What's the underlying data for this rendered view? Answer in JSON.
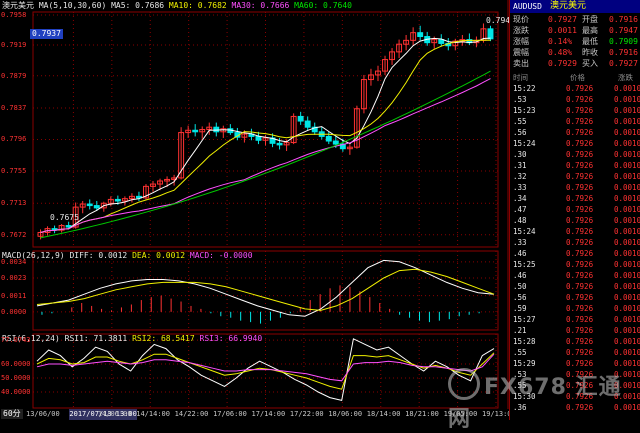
{
  "main_chart": {
    "symbol_label": "澳元美元",
    "ma_title": "MA(5,10,30,60)",
    "ma5": "MA5: 0.7686",
    "ma10": "MA10: 0.7682",
    "ma30": "MA30: 0.7666",
    "ma60": "MA60: 0.7640",
    "current_price_tag": "0.7937",
    "high_label": "0.7947",
    "low_label": "0.7675",
    "y_ticks": [
      "0.7958",
      "0.7919",
      "0.7879",
      "0.7837",
      "0.7796",
      "0.7755",
      "0.7713",
      "0.7672"
    ]
  },
  "macd": {
    "title": "MACD(26,12,9)",
    "diff": "DIFF: 0.0012",
    "dea": "DEA: 0.0012",
    "macd": "MACD: -0.0000",
    "y_ticks": [
      "0.0034",
      "0.0023",
      "0.0011",
      "0.0000"
    ]
  },
  "rsi": {
    "title": "RSI(6,12,24)",
    "rsi1": "RSI1: 71.3811",
    "rsi2": "RSI2: 68.5417",
    "rsi3": "RSI3: 66.9940",
    "y_ticks": [
      "77.0743",
      "60.0000",
      "50.0000",
      "40.0000"
    ]
  },
  "x_axis": {
    "period": "60分",
    "labels": [
      "13/06/00",
      "2017/07/13 13:00",
      "14/06:00",
      "14/14:00",
      "14/22:00",
      "17/06:00",
      "17/14:00",
      "17/22:00",
      "18/06:00",
      "18/14:00",
      "18/21:00",
      "19/05:00",
      "19/13:00"
    ]
  },
  "quote_panel": {
    "code": "AUDUSD",
    "name": "澳元美元",
    "rows": [
      {
        "l1": "现价",
        "v1": "0.7927",
        "l2": "开盘",
        "v2": "0.7916"
      },
      {
        "l1": "涨跌",
        "v1": "0.0011",
        "l2": "最高",
        "v2": "0.7947"
      },
      {
        "l1": "涨幅",
        "v1": "0.14%",
        "l2": "最低",
        "v2": "0.7909"
      },
      {
        "l1": "震幅",
        "v1": "0.48%",
        "l2": "昨收",
        "v2": "0.7916"
      },
      {
        "l1": "卖出",
        "v1": "0.7929",
        "l2": "买入",
        "v2": "0.7927"
      }
    ],
    "header": {
      "time": "时间",
      "price": "价格",
      "change": "涨跌"
    },
    "ticks": [
      {
        "time": "15:22",
        "price": "0.7926",
        "change": "0.0010"
      },
      {
        "time": ".53",
        "price": "0.7926",
        "change": "0.0010"
      },
      {
        "time": "15:23",
        "price": "0.7926",
        "change": "0.0010"
      },
      {
        "time": ".55",
        "price": "0.7926",
        "change": "0.0010"
      },
      {
        "time": ".56",
        "price": "0.7926",
        "change": "0.0010"
      },
      {
        "time": "15:24",
        "price": "0.7926",
        "change": "0.0010"
      },
      {
        "time": ".30",
        "price": "0.7926",
        "change": "0.0010"
      },
      {
        "time": ".31",
        "price": "0.7926",
        "change": "0.0010"
      },
      {
        "time": ".32",
        "price": "0.7926",
        "change": "0.0010"
      },
      {
        "time": ".33",
        "price": "0.7926",
        "change": "0.0010"
      },
      {
        "time": ".34",
        "price": "0.7926",
        "change": "0.0010"
      },
      {
        "time": ".47",
        "price": "0.7926",
        "change": "0.0010"
      },
      {
        "time": ".48",
        "price": "0.7926",
        "change": "0.0010"
      },
      {
        "time": "15:24",
        "price": "0.7926",
        "change": "0.0010"
      },
      {
        "time": ".33",
        "price": "0.7926",
        "change": "0.0010"
      },
      {
        "time": ".46",
        "price": "0.7926",
        "change": "0.0010"
      },
      {
        "time": "15:25",
        "price": "0.7926",
        "change": "0.0010"
      },
      {
        "time": ".46",
        "price": "0.7926",
        "change": "0.0010"
      },
      {
        "time": ".50",
        "price": "0.7926",
        "change": "0.0010"
      },
      {
        "time": ".56",
        "price": "0.7926",
        "change": "0.0010"
      },
      {
        "time": ".59",
        "price": "0.7926",
        "change": "0.0010"
      },
      {
        "time": "15:27",
        "price": "0.7926",
        "change": "0.0010"
      },
      {
        "time": ".21",
        "price": "0.7926",
        "change": "0.0010"
      },
      {
        "time": "15:28",
        "price": "0.7926",
        "change": "0.0010"
      },
      {
        "time": ".55",
        "price": "0.7926",
        "change": "0.0010"
      },
      {
        "time": "15:29",
        "price": "0.7926",
        "change": "0.0010"
      },
      {
        "time": ".53",
        "price": "0.7926",
        "change": "0.0010"
      },
      {
        "time": ".55",
        "price": "0.7926",
        "change": "0.0010"
      },
      {
        "time": "15:30",
        "price": "0.7926",
        "change": "0.0010"
      },
      {
        "time": ".36",
        "price": "0.7926",
        "change": "0.0010"
      }
    ]
  },
  "watermark": "FX678 汇通网",
  "colors": {
    "up": "#ff3232",
    "down": "#00e6e6",
    "ma5": "#ffffff",
    "ma10": "#f0f000",
    "ma30": "#ff50ff",
    "ma60": "#00c800",
    "axis": "#8a0000"
  },
  "chart_data": {
    "type": "line",
    "price_range": [
      0.766,
      0.7958
    ],
    "candles": [
      [
        0.767,
        0.7679,
        0.7666,
        0.7675
      ],
      [
        0.7675,
        0.7683,
        0.7671,
        0.768
      ],
      [
        0.768,
        0.7684,
        0.7674,
        0.7678
      ],
      [
        0.7678,
        0.7686,
        0.7675,
        0.7684
      ],
      [
        0.7684,
        0.7689,
        0.7679,
        0.7682
      ],
      [
        0.7682,
        0.7714,
        0.768,
        0.7708
      ],
      [
        0.7708,
        0.7716,
        0.77,
        0.7712
      ],
      [
        0.7712,
        0.7718,
        0.7705,
        0.771
      ],
      [
        0.771,
        0.7716,
        0.7703,
        0.7707
      ],
      [
        0.7707,
        0.7715,
        0.7702,
        0.7713
      ],
      [
        0.7713,
        0.7722,
        0.7709,
        0.7718
      ],
      [
        0.7718,
        0.7723,
        0.7711,
        0.7716
      ],
      [
        0.7716,
        0.7722,
        0.771,
        0.7719
      ],
      [
        0.7719,
        0.7726,
        0.7714,
        0.7722
      ],
      [
        0.7722,
        0.7728,
        0.7716,
        0.772
      ],
      [
        0.772,
        0.7738,
        0.7718,
        0.7735
      ],
      [
        0.7735,
        0.7742,
        0.7728,
        0.7738
      ],
      [
        0.7738,
        0.7745,
        0.773,
        0.7742
      ],
      [
        0.7742,
        0.7748,
        0.7734,
        0.7744
      ],
      [
        0.7744,
        0.775,
        0.7736,
        0.7746
      ],
      [
        0.7746,
        0.7812,
        0.7744,
        0.7805
      ],
      [
        0.7805,
        0.7814,
        0.7798,
        0.7808
      ],
      [
        0.7808,
        0.7816,
        0.78,
        0.7806
      ],
      [
        0.7806,
        0.7813,
        0.7797,
        0.7809
      ],
      [
        0.7809,
        0.7818,
        0.7802,
        0.7812
      ],
      [
        0.7812,
        0.7818,
        0.78,
        0.7806
      ],
      [
        0.7806,
        0.7814,
        0.7798,
        0.781
      ],
      [
        0.781,
        0.7816,
        0.7802,
        0.7805
      ],
      [
        0.7805,
        0.7811,
        0.7795,
        0.7799
      ],
      [
        0.7799,
        0.7808,
        0.7792,
        0.7803
      ],
      [
        0.7803,
        0.781,
        0.7795,
        0.78
      ],
      [
        0.78,
        0.7806,
        0.779,
        0.7795
      ],
      [
        0.7795,
        0.7802,
        0.7788,
        0.7798
      ],
      [
        0.7798,
        0.7804,
        0.7786,
        0.7791
      ],
      [
        0.7791,
        0.7798,
        0.7783,
        0.7789
      ],
      [
        0.7789,
        0.7796,
        0.7781,
        0.7792
      ],
      [
        0.7792,
        0.783,
        0.779,
        0.7826
      ],
      [
        0.7826,
        0.7832,
        0.7815,
        0.782
      ],
      [
        0.782,
        0.7826,
        0.7808,
        0.7812
      ],
      [
        0.7812,
        0.7818,
        0.7802,
        0.7806
      ],
      [
        0.7806,
        0.7812,
        0.7796,
        0.78
      ],
      [
        0.78,
        0.7806,
        0.779,
        0.7794
      ],
      [
        0.7794,
        0.78,
        0.7785,
        0.779
      ],
      [
        0.779,
        0.7797,
        0.778,
        0.7784
      ],
      [
        0.7784,
        0.779,
        0.7776,
        0.7786
      ],
      [
        0.7786,
        0.784,
        0.7784,
        0.7836
      ],
      [
        0.7836,
        0.788,
        0.783,
        0.7874
      ],
      [
        0.7874,
        0.7888,
        0.7866,
        0.788
      ],
      [
        0.788,
        0.7892,
        0.7872,
        0.7885
      ],
      [
        0.7885,
        0.7905,
        0.788,
        0.79
      ],
      [
        0.79,
        0.7915,
        0.7893,
        0.791
      ],
      [
        0.791,
        0.7926,
        0.7902,
        0.792
      ],
      [
        0.792,
        0.7932,
        0.7912,
        0.7925
      ],
      [
        0.7925,
        0.7942,
        0.7918,
        0.7935
      ],
      [
        0.7935,
        0.7944,
        0.7925,
        0.793
      ],
      [
        0.793,
        0.7936,
        0.7918,
        0.7922
      ],
      [
        0.7922,
        0.793,
        0.7914,
        0.7926
      ],
      [
        0.7926,
        0.7933,
        0.7917,
        0.7921
      ],
      [
        0.7921,
        0.7928,
        0.7912,
        0.7918
      ],
      [
        0.7918,
        0.7927,
        0.7912,
        0.7924
      ],
      [
        0.7924,
        0.7932,
        0.7918,
        0.7926
      ],
      [
        0.7926,
        0.7934,
        0.7919,
        0.7922
      ],
      [
        0.7922,
        0.793,
        0.7916,
        0.7925
      ],
      [
        0.7925,
        0.7947,
        0.7922,
        0.794
      ],
      [
        0.794,
        0.7944,
        0.7924,
        0.7927
      ]
    ],
    "macd_bars": [
      -0.0002,
      -0.0001,
      0.0,
      0.0003,
      0.0006,
      0.0004,
      0.0002,
      0.0001,
      0.0003,
      0.0005,
      0.0008,
      0.001,
      0.0011,
      0.0009,
      0.0007,
      0.0004,
      0.0002,
      -0.0001,
      -0.0003,
      -0.0004,
      -0.0006,
      -0.0007,
      -0.0008,
      -0.0006,
      -0.0004,
      -0.0001,
      0.0003,
      0.0008,
      0.0012,
      0.0016,
      0.0018,
      0.0017,
      0.0014,
      0.001,
      0.0006,
      0.0002,
      -0.0002,
      -0.0004,
      -0.0006,
      -0.0007,
      -0.0006,
      -0.0005,
      -0.0003,
      -0.0002,
      -0.0001,
      0.0
    ],
    "diff": [
      0.0004,
      0.0006,
      0.0008,
      0.0012,
      0.0016,
      0.0019,
      0.0021,
      0.0022,
      0.0022,
      0.0021,
      0.0019,
      0.0016,
      0.0012,
      0.0008,
      0.0004,
      0.0001,
      -0.0002,
      -0.0003,
      0.0002,
      0.001,
      0.002,
      0.003,
      0.0035,
      0.0034,
      0.003,
      0.0025,
      0.002,
      0.0016,
      0.0013,
      0.0012
    ],
    "dea": [
      0.0005,
      0.0006,
      0.0007,
      0.0009,
      0.0012,
      0.0015,
      0.0017,
      0.0019,
      0.002,
      0.002,
      0.002,
      0.0019,
      0.0017,
      0.0014,
      0.0011,
      0.0008,
      0.0005,
      0.0002,
      0.0001,
      0.0004,
      0.0009,
      0.0016,
      0.0023,
      0.0028,
      0.0029,
      0.0027,
      0.0024,
      0.002,
      0.0016,
      0.0012
    ],
    "rsi1": [
      62,
      70,
      66,
      58,
      64,
      72,
      69,
      60,
      55,
      66,
      74,
      71,
      63,
      58,
      52,
      48,
      44,
      50,
      57,
      62,
      58,
      54,
      49,
      45,
      40,
      36,
      34,
      78,
      74,
      70,
      72,
      66,
      60,
      55,
      62,
      58,
      52,
      48,
      66,
      71
    ],
    "rsi2": [
      60,
      64,
      63,
      60,
      61,
      65,
      65,
      62,
      60,
      63,
      67,
      67,
      64,
      61,
      58,
      55,
      52,
      53,
      55,
      57,
      56,
      54,
      52,
      50,
      47,
      44,
      42,
      66,
      66,
      65,
      66,
      63,
      60,
      57,
      59,
      57,
      54,
      52,
      60,
      68
    ],
    "rsi3": [
      58,
      60,
      60,
      59,
      60,
      61,
      62,
      61,
      60,
      61,
      63,
      63,
      62,
      61,
      59,
      57,
      55,
      55,
      56,
      56,
      56,
      55,
      54,
      53,
      51,
      49,
      48,
      60,
      61,
      61,
      62,
      61,
      59,
      58,
      58,
      57,
      56,
      55,
      58,
      67
    ]
  }
}
